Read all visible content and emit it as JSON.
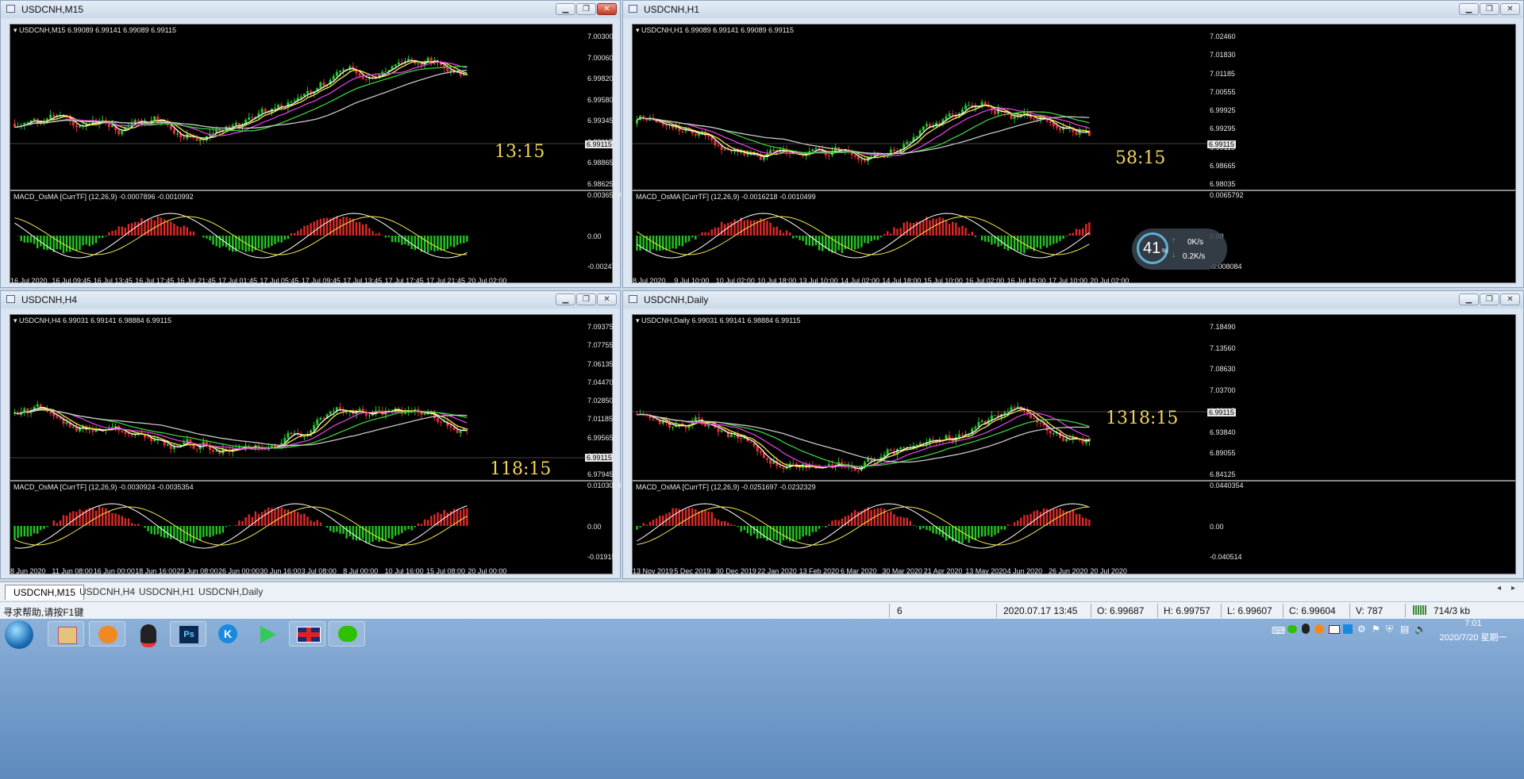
{
  "windows": [
    {
      "id": "m15",
      "title": "USDCNH,M15",
      "info": "USDCNH,M15  6.99089 6.99141 6.99089 6.99115",
      "prices": [
        "7.00300",
        "7.00060",
        "6.99820",
        "6.99580",
        "6.99345",
        "6.99115",
        "6.98865",
        "6.98625"
      ],
      "price_tag": "6.99115",
      "macd": "MACD_OsMA [CurrTF] (12,26,9) -0.0007896 -0.0010992",
      "macd_scale": [
        "0.0036559",
        "0.00",
        "-0.002476"
      ],
      "times": [
        "16 Jul 2020",
        "16 Jul 09:45",
        "16 Jul 13:45",
        "16 Jul 17:45",
        "16 Jul 21:45",
        "17 Jul 01:45",
        "17 Jul 05:45",
        "17 Jul 09:45",
        "17 Jul 13:45",
        "17 Jul 17:45",
        "17 Jul 21:45",
        "20 Jul 02:00"
      ],
      "timer": "13:15"
    },
    {
      "id": "h1",
      "title": "USDCNH,H1",
      "info": "USDCNH,H1  6.99089 6.99141 6.99089 6.99115",
      "prices": [
        "7.02460",
        "7.01830",
        "7.01185",
        "7.00555",
        "6.99925",
        "6.99295",
        "6.99115",
        "6.98665",
        "6.98035"
      ],
      "price_tag": "6.99115",
      "macd": "MACD_OsMA [CurrTF] (12,26,9) -0.0016218 -0.0010499",
      "macd_scale": [
        "0.0065792",
        "0.00",
        "-0.008084"
      ],
      "times": [
        "8 Jul 2020",
        "9 Jul 10:00",
        "10 Jul 02:00",
        "10 Jul 18:00",
        "13 Jul 10:00",
        "14 Jul 02:00",
        "14 Jul 18:00",
        "15 Jul 10:00",
        "16 Jul 02:00",
        "16 Jul 18:00",
        "17 Jul 10:00",
        "20 Jul 02:00"
      ],
      "timer": "58:15"
    },
    {
      "id": "h4",
      "title": "USDCNH,H4",
      "info": "USDCNH,H4  6.99031 6.99141 6.98884 6.99115",
      "prices": [
        "7.09375",
        "7.07755",
        "7.06135",
        "7.04470",
        "7.02850",
        "7.01185",
        "6.99565",
        "6.99115",
        "6.97945"
      ],
      "price_tag": "6.99115",
      "macd": "MACD_OsMA [CurrTF] (12,26,9) -0.0030924 -0.0035354",
      "macd_scale": [
        "0.0103008",
        "0.00",
        "-0.019195"
      ],
      "times": [
        "8 Jun 2020",
        "11 Jun 08:00",
        "16 Jun 00:00",
        "18 Jun 16:00",
        "23 Jun 08:00",
        "26 Jun 00:00",
        "30 Jun 16:00",
        "3 Jul 08:00",
        "8 Jul 00:00",
        "10 Jul 16:00",
        "15 Jul 08:00",
        "20 Jul 00:00"
      ],
      "timer": "118:15"
    },
    {
      "id": "d1",
      "title": "USDCNH,Daily",
      "info": "USDCNH,Daily  6.99031 6.99141 6.98884 6.99115",
      "prices": [
        "7.18490",
        "7.13560",
        "7.08630",
        "7.03700",
        "6.99115",
        "6.93840",
        "6.89055",
        "6.84125"
      ],
      "price_tag": "6.99115",
      "macd": "MACD_OsMA [CurrTF] (12,26,9) -0.0251697 -0.0232329",
      "macd_scale": [
        "0.0440354",
        "0.00",
        "-0.040514"
      ],
      "times": [
        "13 Nov 2019",
        "5 Dec 2019",
        "30 Dec 2019",
        "22 Jan 2020",
        "13 Feb 2020",
        "6 Mar 2020",
        "30 Mar 2020",
        "21 Apr 2020",
        "13 May 2020",
        "4 Jun 2020",
        "26 Jun 2020",
        "20 Jul 2020"
      ],
      "timer": "1318:15"
    }
  ],
  "tabs": [
    "USDCNH,M15",
    "USDCNH,H4",
    "USDCNH,H1",
    "USDCNH,Daily"
  ],
  "status": {
    "help": "寻求帮助,请按F1键",
    "count": "6",
    "datetime": "2020.07.17 13:45",
    "open": "O: 6.99687",
    "high": "H: 6.99757",
    "low": "L: 6.99607",
    "close": "C: 6.99604",
    "volume": "V: 787",
    "traffic": "714/3 kb"
  },
  "net": {
    "percent": "41",
    "unit": "%",
    "up": "0K/s",
    "down": "0.2K/s"
  },
  "clock": {
    "time": "7:01",
    "date": "2020/7/20 星期一"
  },
  "taskbar_icons": [
    "start-orb",
    "file-manager",
    "foxmail",
    "qq",
    "photoshop",
    "kugou",
    "media-player",
    "uk-flag-app",
    "wechat"
  ]
}
